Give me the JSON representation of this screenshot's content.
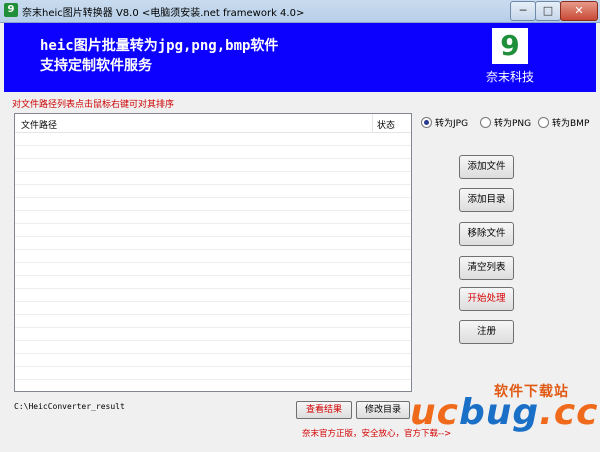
{
  "window": {
    "title": "奈末heic图片转换器 V8.0 <电脑须安装.net framework 4.0>",
    "icon_glyph": "9",
    "min_glyph": "─",
    "max_glyph": "□",
    "close_glyph": "✕"
  },
  "banner": {
    "line1": "heic图片批量转为jpg,png,bmp软件",
    "line2": "支持定制软件服务",
    "logo_glyph": "9",
    "logo_text": "奈末科技",
    "bg_color": "#0c00ff"
  },
  "hint": "对文件路径列表点击鼠标右键可对其排序",
  "file_list": {
    "columns": [
      "文件路径",
      "状态"
    ],
    "rows": []
  },
  "format_options": [
    {
      "label": "转为JPG",
      "selected": true
    },
    {
      "label": "转为PNG",
      "selected": false
    },
    {
      "label": "转为BMP",
      "selected": false
    }
  ],
  "buttons": {
    "add_file": "添加文件",
    "add_dir": "添加目录",
    "remove_file": "移除文件",
    "clear_list": "清空列表",
    "start": "开始处理",
    "register": "注册"
  },
  "output": {
    "path": "C:\\HeicConverter_result",
    "view_label": "查看结果",
    "edit_label": "修改目录"
  },
  "footer_text": "奈末官方正版，安全放心，官方下载-->",
  "watermark": {
    "cn": "软件下载站",
    "brand_a": "uc",
    "brand_b": "bug",
    "brand_c": ".cc"
  }
}
